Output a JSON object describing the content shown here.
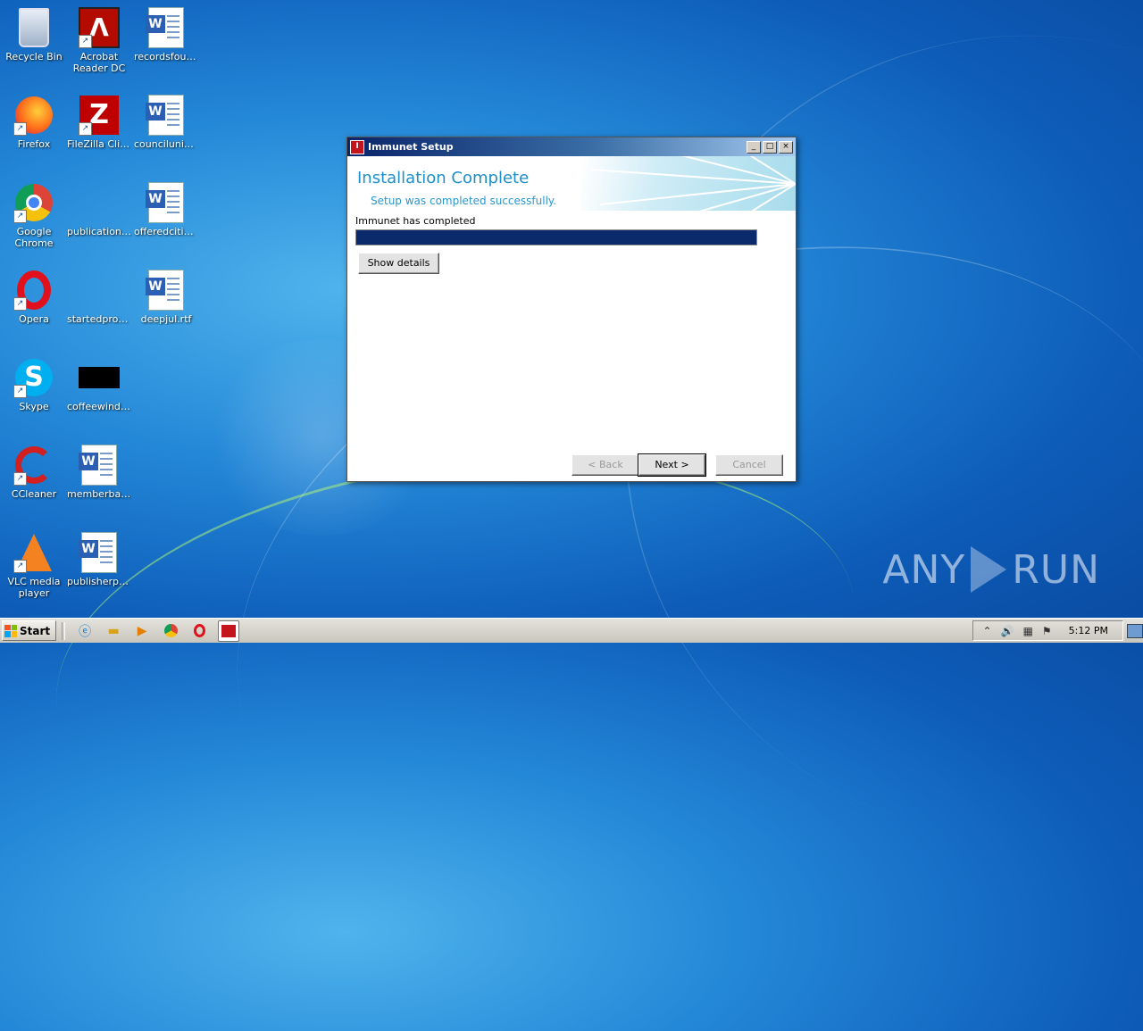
{
  "desktop": {
    "icons": [
      {
        "label": "Recycle Bin",
        "icon": "recycle-bin-icon"
      },
      {
        "label": "Acrobat Reader DC",
        "icon": "acrobat-icon"
      },
      {
        "label": "recordsfoun...",
        "icon": "word-document-icon"
      },
      {
        "label": "Firefox",
        "icon": "firefox-icon"
      },
      {
        "label": "FileZilla Client",
        "icon": "filezilla-icon"
      },
      {
        "label": "counciluniv...",
        "icon": "word-document-icon"
      },
      {
        "label": "Google Chrome",
        "icon": "chrome-icon"
      },
      {
        "label": "publicationfi...",
        "icon": "blank-file-icon"
      },
      {
        "label": "offeredcitie...",
        "icon": "word-document-icon"
      },
      {
        "label": "Opera",
        "icon": "opera-icon"
      },
      {
        "label": "startedprop...",
        "icon": "blank-file-icon"
      },
      {
        "label": "deepjul.rtf",
        "icon": "word-document-icon"
      },
      {
        "label": "Skype",
        "icon": "skype-icon"
      },
      {
        "label": "coffeewindo...",
        "icon": "black-image-icon"
      },
      {
        "label": "CCleaner",
        "icon": "ccleaner-icon"
      },
      {
        "label": "memberbag...",
        "icon": "word-document-icon"
      },
      {
        "label": "VLC media player",
        "icon": "vlc-icon"
      },
      {
        "label": "publisherpro...",
        "icon": "word-document-icon"
      }
    ]
  },
  "window": {
    "title": "Immunet Setup",
    "heading": "Installation Complete",
    "subheading": "Setup was completed successfully.",
    "status": "Immunet has completed",
    "progress": 1.0,
    "show_details_label": "Show details",
    "back_label": "< Back",
    "next_label": "Next >",
    "cancel_label": "Cancel",
    "controls": {
      "minimize": "_",
      "maximize": "□",
      "close": "×"
    }
  },
  "taskbar": {
    "start_label": "Start",
    "clock": "5:12 PM",
    "apps": [
      "internet-explorer-icon",
      "file-explorer-icon",
      "media-player-icon",
      "chrome-icon",
      "opera-icon",
      "immunet-setup-icon"
    ]
  },
  "watermark": {
    "left": "ANY",
    "right": "RUN"
  },
  "colors": {
    "accent": "#1e8fc7",
    "progress": "#0b2a6b",
    "title_bar": "#0a246a"
  }
}
